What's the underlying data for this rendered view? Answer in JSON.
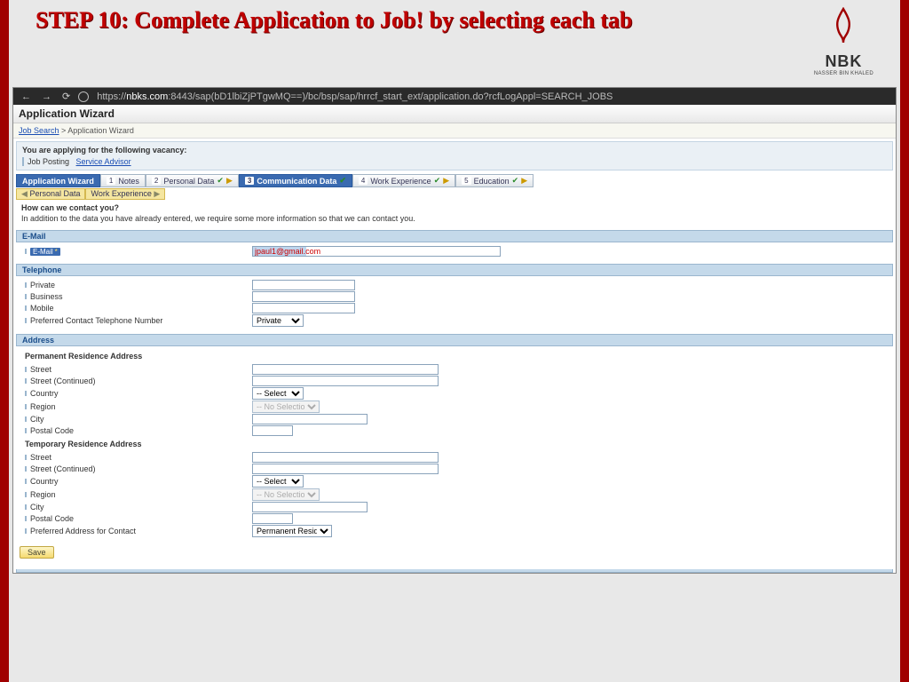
{
  "slide": {
    "title": "STEP 10: Complete Application to Job! by selecting each tab",
    "logo_text": "NBK",
    "logo_sub": "NASSER BIN KHALED"
  },
  "browser": {
    "url_prefix": "https://",
    "url_domain": "nbks.com",
    "url_rest": ":8443/sap(bD1lbiZjPTgwMQ==)/bc/bsp/sap/hrrcf_start_ext/application.do?rcfLogAppl=SEARCH_JOBS"
  },
  "wizard": {
    "title": "Application Wizard",
    "breadcrumb_link": "Job Search",
    "breadcrumb_current": "Application Wizard",
    "vacancy_label": "You are applying for the following vacancy:",
    "job_posting_label": "Job Posting",
    "job_posting_link": "Service Advisor",
    "tabs": {
      "t0": "Application Wizard",
      "t1": "Notes",
      "t2": "Personal Data",
      "t3": "Communication Data",
      "t4": "Work Experience",
      "t5": "Education"
    },
    "subtabs": {
      "prev": "Personal Data",
      "next": "Work Experience"
    },
    "question": "How can we contact you?",
    "question_sub": "In addition to the data you have already entered, we require some more information so that we can contact you.",
    "sections": {
      "email": "E-Mail",
      "telephone": "Telephone",
      "address": "Address"
    },
    "email": {
      "badge": "E-Mail",
      "value": "jpaul1@gmail.com"
    },
    "telephone": {
      "private": "Private",
      "business": "Business",
      "mobile": "Mobile",
      "pref": "Preferred Contact Telephone Number",
      "pref_value": "Private"
    },
    "address": {
      "perm_head": "Permanent Residence Address",
      "temp_head": "Temporary Residence Address",
      "street": "Street",
      "street2": "Street (Continued)",
      "country": "Country",
      "country_value": "-- Select --",
      "region": "Region",
      "region_value": "-- No Selection Possible --",
      "city": "City",
      "postal": "Postal Code",
      "pref_addr": "Preferred Address for Contact",
      "pref_addr_value": "Permanent Residence"
    },
    "save": "Save"
  }
}
